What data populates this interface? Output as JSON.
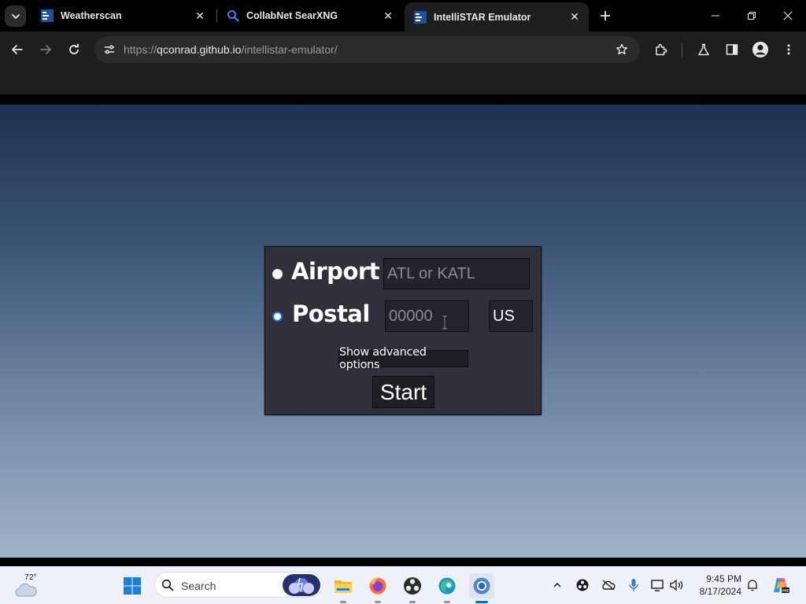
{
  "browser": {
    "tabs": [
      {
        "title": "Weatherscan",
        "active": false
      },
      {
        "title": "CollabNet SearXNG",
        "active": false
      },
      {
        "title": "IntelliSTAR Emulator",
        "active": true
      }
    ],
    "address_bar": {
      "scheme": "https://",
      "host": "qconrad.github.io",
      "path": "/intellistar-emulator/"
    }
  },
  "form": {
    "airport": {
      "label": "Airport",
      "placeholder": "ATL or KATL",
      "selected": false
    },
    "postal": {
      "label": "Postal",
      "placeholder": "00000",
      "country": "US",
      "selected": true
    },
    "advanced_button": "Show advanced options",
    "start_button": "Start"
  },
  "taskbar": {
    "weather_temp": "72°",
    "search_placeholder": "Search",
    "apps": [
      "start",
      "file-explorer",
      "firefox",
      "obs",
      "edge",
      "chrome"
    ],
    "time": "9:45 PM",
    "date": "8/17/2024"
  },
  "colors": {
    "page_gradient_top": "#1d3150",
    "page_gradient_bottom": "#a1b3c9",
    "panel_bg": "#312f3a",
    "field_bg": "#24222b",
    "radio_accent": "#1a73e8"
  }
}
